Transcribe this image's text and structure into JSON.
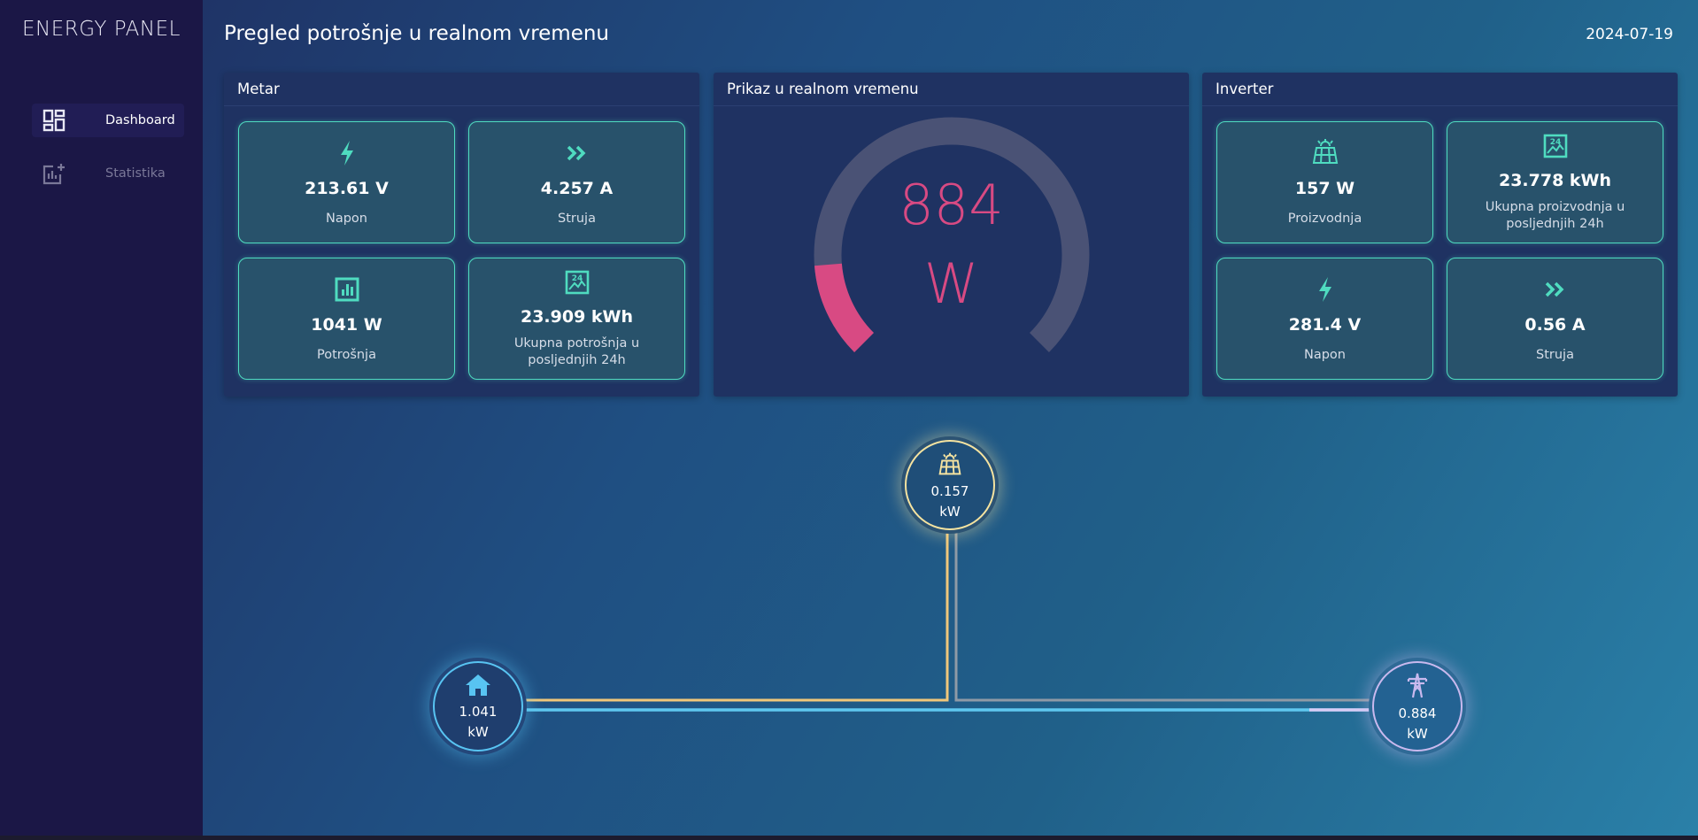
{
  "app": {
    "brand": "ENERGY PANEL"
  },
  "sidebar": {
    "items": [
      {
        "label": "Dashboard",
        "icon": "dashboard-icon",
        "active": true
      },
      {
        "label": "Statistika",
        "icon": "statistics-icon",
        "active": false
      }
    ]
  },
  "header": {
    "title": "Pregled potrošnje u realnom vremenu",
    "date": "2024-07-19"
  },
  "meter": {
    "title": "Metar",
    "cards": [
      {
        "value": "213.61 V",
        "label": "Napon",
        "icon": "lightning-icon"
      },
      {
        "value": "4.257 A",
        "label": "Struja",
        "icon": "double-chevron-icon"
      },
      {
        "value": "1041 W",
        "label": "Potrošnja",
        "icon": "bar-chart-icon"
      },
      {
        "value": "23.909 kWh",
        "label": "Ukupna potrošnja u posljednjih 24h",
        "icon": "image-24h-icon"
      }
    ]
  },
  "realtime": {
    "title": "Prikaz u realnom vremenu",
    "value": "884",
    "unit": "W",
    "fill_fraction": 0.15
  },
  "inverter": {
    "title": "Inverter",
    "cards": [
      {
        "value": "157 W",
        "label": "Proizvodnja",
        "icon": "solar-panel-icon"
      },
      {
        "value": "23.778 kWh",
        "label": "Ukupna proizvodnja u posljednjih 24h",
        "icon": "image-24h-icon"
      },
      {
        "value": "281.4 V",
        "label": "Napon",
        "icon": "lightning-icon"
      },
      {
        "value": "0.56 A",
        "label": "Struja",
        "icon": "double-chevron-icon"
      }
    ]
  },
  "flow": {
    "solar": {
      "value": "0.157",
      "unit": "kW",
      "icon": "solar-panel-icon"
    },
    "home": {
      "value": "1.041",
      "unit": "kW",
      "icon": "home-icon"
    },
    "grid": {
      "value": "0.884",
      "unit": "kW",
      "icon": "power-tower-icon"
    }
  },
  "colors": {
    "accent": "#4fdcc0",
    "gauge_fill": "#d84a83",
    "gauge_track": "#4a5275",
    "solar": "#f5e3a0",
    "home": "#58c4f2",
    "grid": "#c9b9ee"
  }
}
